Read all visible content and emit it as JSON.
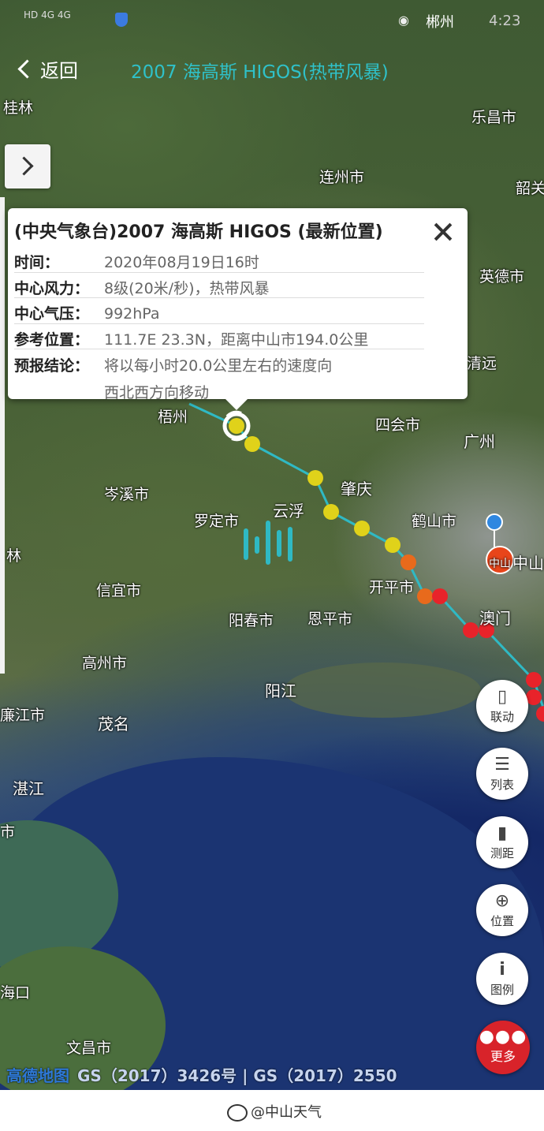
{
  "status_bar": {
    "signal": "HD 4G 4G",
    "city": "郴州",
    "time": "4:23"
  },
  "header": {
    "back_label": "返回",
    "title": "2007 海高斯 HIGOS(热带风暴)"
  },
  "popup": {
    "title": "(中央气象台)2007 海高斯 HIGOS (最新位置)",
    "rows": [
      {
        "label": "时间：",
        "value": "2020年08月19日16时"
      },
      {
        "label": "中心风力：",
        "value": "8级(20米/秒)，热带风暴"
      },
      {
        "label": "中心气压：",
        "value": "992hPa"
      },
      {
        "label": "参考位置：",
        "value": "111.7E 23.3N，距离中山市194.0公里"
      },
      {
        "label": "预报结论：",
        "value": "将以每小时20.0公里左右的速度向",
        "value2": "西北西方向移动"
      }
    ]
  },
  "places": [
    "桂林",
    "乐昌市",
    "连州市",
    "韶关",
    "英德市",
    "清远",
    "梧州",
    "四会市",
    "广州",
    "岑溪市",
    "肇庆",
    "云浮",
    "罗定市",
    "鹤山市",
    "中山",
    "开平市",
    "信宜市",
    "阳春市",
    "恩平市",
    "澳门",
    "高州市",
    "阳江",
    "廉江市",
    "茂名",
    "湛江",
    "文昌市",
    "海口",
    "林",
    "市"
  ],
  "zhongshan_marker": "中山",
  "buttons": [
    {
      "label": "联动",
      "icon": "phone-icon"
    },
    {
      "label": "列表",
      "icon": "list-icon"
    },
    {
      "label": "测距",
      "icon": "ruler-icon"
    },
    {
      "label": "位置",
      "icon": "locate-icon"
    },
    {
      "label": "图例",
      "icon": "info-icon"
    }
  ],
  "more_label": "更多",
  "attribution": {
    "logo": "高德地图",
    "text": "GS（2017）3426号 | GS（2017）2550"
  },
  "footer": {
    "weibo": "@中山天气"
  },
  "colors": {
    "track_line": "#2fb9c4",
    "tropical_storm": "#e0d21a",
    "strong_storm": "#e86a1c",
    "typhoon": "#e8232a",
    "accent": "#2fc1c9"
  }
}
